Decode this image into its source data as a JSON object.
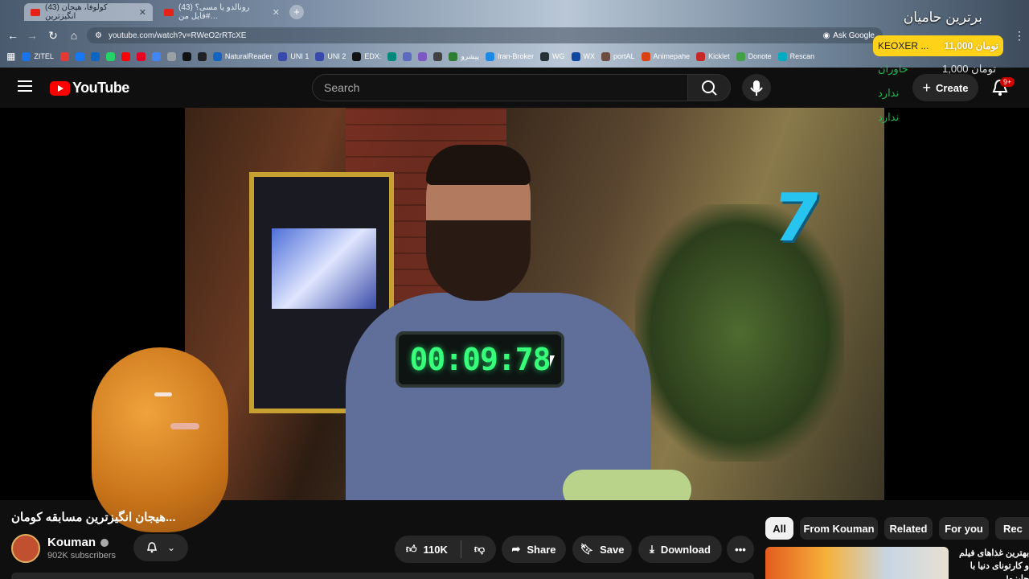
{
  "browser": {
    "tabs": [
      {
        "label": "(43) کولوفا، هیجان انگیزترین",
        "active": true
      },
      {
        "label": "(43) رونالدو یا مسی؟ #فایل من…",
        "active": false
      }
    ],
    "url": "youtube.com/watch?v=RWeO2rRTcXE",
    "ask_google": "Ask Google",
    "bookmarks": [
      {
        "label": "ZITEL",
        "color": "#1a73e8"
      },
      {
        "label": "",
        "color": "#e53935"
      },
      {
        "label": "",
        "color": "#1877f2"
      },
      {
        "label": "",
        "color": "#0a66c2"
      },
      {
        "label": "",
        "color": "#25d366"
      },
      {
        "label": "",
        "color": "#ff0000"
      },
      {
        "label": "",
        "color": "#e60023"
      },
      {
        "label": "",
        "color": "#4285f4"
      },
      {
        "label": "",
        "color": "#9aa0a6"
      },
      {
        "label": "",
        "color": "#111111"
      },
      {
        "label": "",
        "color": "#202124"
      },
      {
        "label": "NaturalReader",
        "color": "#1565c0"
      },
      {
        "label": "UNI 1",
        "color": "#3949ab"
      },
      {
        "label": "UNI 2",
        "color": "#3949ab"
      },
      {
        "label": "EDX:",
        "color": "#111111"
      },
      {
        "label": "",
        "color": "#00897b"
      },
      {
        "label": "",
        "color": "#5c6bc0"
      },
      {
        "label": "",
        "color": "#7e57c2"
      },
      {
        "label": "",
        "color": "#424242"
      },
      {
        "label": "پیشرو",
        "color": "#2e7d32"
      },
      {
        "label": "Iran-Broker",
        "color": "#1e88e5"
      },
      {
        "label": "WG",
        "color": "#263238"
      },
      {
        "label": "WX",
        "color": "#0d47a1"
      },
      {
        "label": "portAL",
        "color": "#6d4c41"
      },
      {
        "label": "Animepahe",
        "color": "#d84315"
      },
      {
        "label": "Kicklet",
        "color": "#c62828"
      },
      {
        "label": "Donote",
        "color": "#43a047"
      },
      {
        "label": "Rescan",
        "color": "#00acc1"
      }
    ]
  },
  "youtube": {
    "logo_text": "YouTube",
    "search_placeholder": "Search",
    "create_label": "Create",
    "notifications_badge": "9+"
  },
  "overlay": {
    "title": "برترین حامیان",
    "pill_name": "KEOXER ...",
    "pill_amount": "11,000 تومان",
    "rows": [
      "خاوران",
      "ندارد",
      "ندارد"
    ],
    "side_amount": "1,000 تومان"
  },
  "video": {
    "timer": "00:09:78",
    "overlay_number": "7"
  },
  "watch": {
    "title": "...هیجان انگیزترین مسابقه کومان",
    "channel_name": "Kouman",
    "subscribers": "902K subscribers",
    "likes": "110K",
    "share_label": "Share",
    "save_label": "Save",
    "download_label": "Download",
    "more_label": "•••"
  },
  "chips": [
    {
      "label": "All",
      "active": true
    },
    {
      "label": "From Kouman",
      "active": false
    },
    {
      "label": "Related",
      "active": false
    },
    {
      "label": "For you",
      "active": false
    },
    {
      "label": "Rec",
      "active": false
    }
  ],
  "recommendation": {
    "title": "بهترین غذاهای فیلم و کارتونای دنیا با جایزه!"
  },
  "colors": {
    "brand_red": "#ff0000",
    "timer_green": "#37ff7a",
    "overlay_yellow": "#ffd21a",
    "number_cyan": "#28c4f0"
  }
}
